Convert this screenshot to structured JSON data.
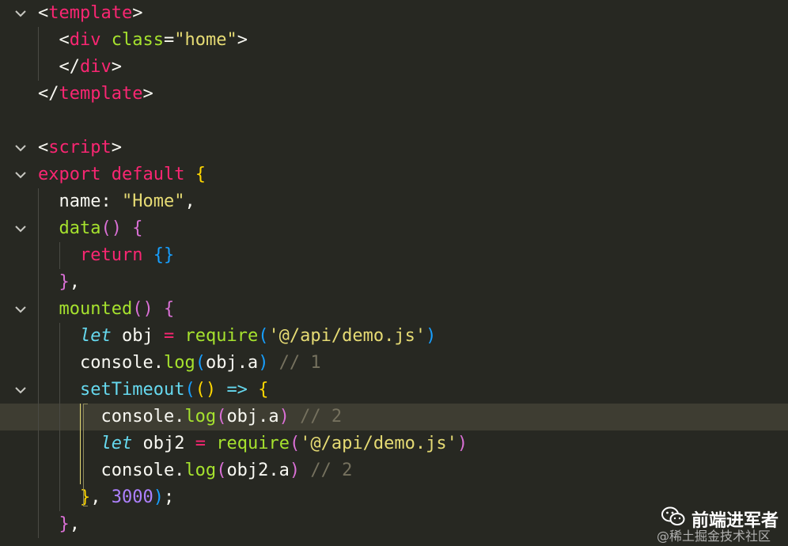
{
  "editor": {
    "lines": [
      [
        {
          "t": "<",
          "c": "t-punc"
        },
        {
          "t": "template",
          "c": "t-tag"
        },
        {
          "t": ">",
          "c": "t-punc"
        }
      ],
      [
        {
          "t": "  <",
          "c": "t-punc"
        },
        {
          "t": "div",
          "c": "t-tag"
        },
        {
          "t": " ",
          "c": "t-plain"
        },
        {
          "t": "class",
          "c": "t-attr"
        },
        {
          "t": "=",
          "c": "t-punc"
        },
        {
          "t": "\"home\"",
          "c": "t-str"
        },
        {
          "t": ">",
          "c": "t-punc"
        }
      ],
      [
        {
          "t": "  </",
          "c": "t-punc"
        },
        {
          "t": "div",
          "c": "t-tag"
        },
        {
          "t": ">",
          "c": "t-punc"
        }
      ],
      [
        {
          "t": "</",
          "c": "t-punc"
        },
        {
          "t": "template",
          "c": "t-tag"
        },
        {
          "t": ">",
          "c": "t-punc"
        }
      ],
      [],
      [
        {
          "t": "<",
          "c": "t-punc"
        },
        {
          "t": "script",
          "c": "t-tag"
        },
        {
          "t": ">",
          "c": "t-punc"
        }
      ],
      [
        {
          "t": "export",
          "c": "t-kw"
        },
        {
          "t": " ",
          "c": "t-plain"
        },
        {
          "t": "default",
          "c": "t-kw"
        },
        {
          "t": " ",
          "c": "t-plain"
        },
        {
          "t": "{",
          "c": "t-brace-yellow"
        }
      ],
      [
        {
          "t": "  name: ",
          "c": "t-plain"
        },
        {
          "t": "\"Home\"",
          "c": "t-str"
        },
        {
          "t": ",",
          "c": "t-plain"
        }
      ],
      [
        {
          "t": "  ",
          "c": "t-plain"
        },
        {
          "t": "data",
          "c": "t-fn"
        },
        {
          "t": "()",
          "c": "t-paren"
        },
        {
          "t": " ",
          "c": "t-plain"
        },
        {
          "t": "{",
          "c": "t-brace-pink"
        }
      ],
      [
        {
          "t": "    ",
          "c": "t-plain"
        },
        {
          "t": "return",
          "c": "t-kw"
        },
        {
          "t": " ",
          "c": "t-plain"
        },
        {
          "t": "{}",
          "c": "t-brace-blue"
        }
      ],
      [
        {
          "t": "  ",
          "c": "t-plain"
        },
        {
          "t": "}",
          "c": "t-brace-pink"
        },
        {
          "t": ",",
          "c": "t-plain"
        }
      ],
      [
        {
          "t": "  ",
          "c": "t-plain"
        },
        {
          "t": "mounted",
          "c": "t-fn"
        },
        {
          "t": "()",
          "c": "t-paren"
        },
        {
          "t": " ",
          "c": "t-plain"
        },
        {
          "t": "{",
          "c": "t-brace-pink"
        }
      ],
      [
        {
          "t": "    ",
          "c": "t-plain"
        },
        {
          "t": "let",
          "c": "t-let"
        },
        {
          "t": " obj ",
          "c": "t-plain"
        },
        {
          "t": "=",
          "c": "t-op"
        },
        {
          "t": " ",
          "c": "t-plain"
        },
        {
          "t": "require",
          "c": "t-fn"
        },
        {
          "t": "(",
          "c": "t-paren2"
        },
        {
          "t": "'@/api/demo.js'",
          "c": "t-str"
        },
        {
          "t": ")",
          "c": "t-paren2"
        }
      ],
      [
        {
          "t": "    console.",
          "c": "t-plain"
        },
        {
          "t": "log",
          "c": "t-fn"
        },
        {
          "t": "(",
          "c": "t-paren2"
        },
        {
          "t": "obj.a",
          "c": "t-plain"
        },
        {
          "t": ")",
          "c": "t-paren2"
        },
        {
          "t": " // 1",
          "c": "t-com"
        }
      ],
      [
        {
          "t": "    ",
          "c": "t-plain"
        },
        {
          "t": "setTimeout",
          "c": "t-builtin"
        },
        {
          "t": "(",
          "c": "t-paren2"
        },
        {
          "t": "()",
          "c": "t-brace-yellow"
        },
        {
          "t": " ",
          "c": "t-plain"
        },
        {
          "t": "=>",
          "c": "t-builtin"
        },
        {
          "t": " ",
          "c": "t-plain"
        },
        {
          "t": "{",
          "c": "t-brace-yellow"
        }
      ],
      [
        {
          "t": "      console.",
          "c": "t-plain"
        },
        {
          "t": "log",
          "c": "t-fn"
        },
        {
          "t": "(",
          "c": "t-paren"
        },
        {
          "t": "obj.a",
          "c": "t-plain"
        },
        {
          "t": ")",
          "c": "t-paren"
        },
        {
          "t": " // 2",
          "c": "t-com"
        }
      ],
      [
        {
          "t": "      ",
          "c": "t-plain"
        },
        {
          "t": "let",
          "c": "t-let"
        },
        {
          "t": " obj2 ",
          "c": "t-plain"
        },
        {
          "t": "=",
          "c": "t-op"
        },
        {
          "t": " ",
          "c": "t-plain"
        },
        {
          "t": "require",
          "c": "t-fn"
        },
        {
          "t": "(",
          "c": "t-paren"
        },
        {
          "t": "'@/api/demo.js'",
          "c": "t-str"
        },
        {
          "t": ")",
          "c": "t-paren"
        }
      ],
      [
        {
          "t": "      console.",
          "c": "t-plain"
        },
        {
          "t": "log",
          "c": "t-fn"
        },
        {
          "t": "(",
          "c": "t-paren"
        },
        {
          "t": "obj2.a",
          "c": "t-plain"
        },
        {
          "t": ")",
          "c": "t-paren"
        },
        {
          "t": " // 2",
          "c": "t-com"
        }
      ],
      [
        {
          "t": "    ",
          "c": "t-plain"
        },
        {
          "t": "}",
          "c": "t-brace-yellow"
        },
        {
          "t": ", ",
          "c": "t-plain"
        },
        {
          "t": "3000",
          "c": "t-num"
        },
        {
          "t": ")",
          "c": "t-paren2"
        },
        {
          "t": ";",
          "c": "t-plain"
        }
      ],
      [
        {
          "t": "  ",
          "c": "t-plain"
        },
        {
          "t": "}",
          "c": "t-brace-pink"
        },
        {
          "t": ",",
          "c": "t-plain"
        }
      ]
    ],
    "fold_lines": [
      0,
      5,
      6,
      8,
      11,
      14
    ],
    "highlight_line": 15
  },
  "watermark": {
    "title": "前端进军者",
    "subtitle": "@稀土掘金技术社区",
    "icon": "wechat-icon"
  }
}
